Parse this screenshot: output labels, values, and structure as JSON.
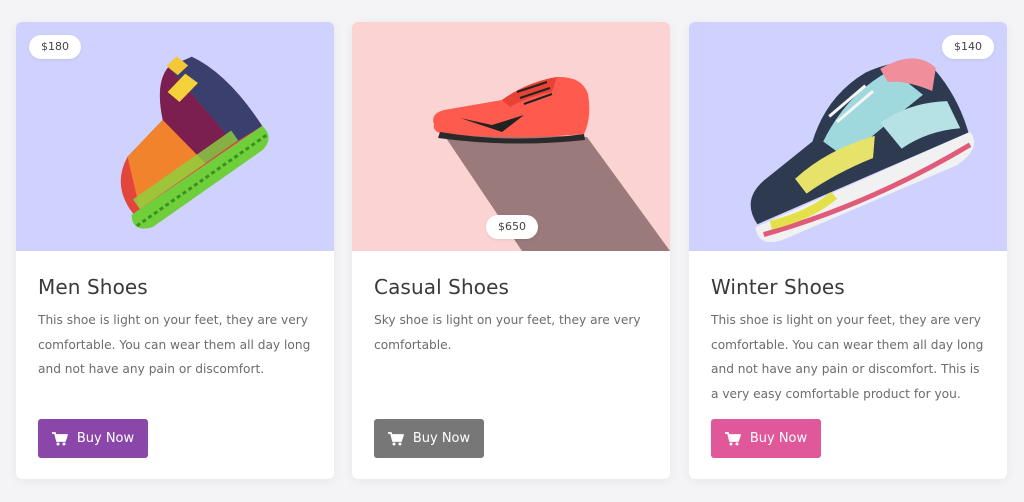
{
  "colors": {
    "card_1_media_bg": "#cfd1ff",
    "card_2_media_bg": "#fcd3d3",
    "card_3_media_bg": "#cfd1ff",
    "button_purple": "#8a47a9",
    "button_gray": "#777777",
    "button_pink": "#e0579a"
  },
  "cards": [
    {
      "price": "$180",
      "title": "Men Shoes",
      "description": "This shoe is light on your feet, they are very comfortable. You can wear them all day long and not have any pain or discomfort.",
      "button_label": "Buy Now",
      "button_icon": "cart-icon",
      "image_icon": "sneaker-image"
    },
    {
      "price": "$650",
      "title": "Casual Shoes",
      "description": "Sky shoe is light on your feet, they are very comfortable.",
      "button_label": "Buy Now",
      "button_icon": "cart-icon",
      "image_icon": "sneaker-image"
    },
    {
      "price": "$140",
      "title": "Winter Shoes",
      "description": "This shoe is light on your feet, they are very comfortable. You can wear them all day long and not have any pain or discomfort. This is a very easy comfortable product for you.",
      "button_label": "Buy Now",
      "button_icon": "cart-icon",
      "image_icon": "sneaker-image"
    }
  ]
}
